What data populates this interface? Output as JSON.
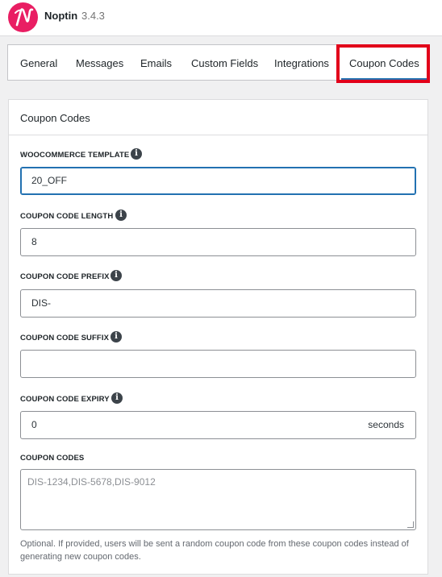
{
  "app": {
    "name": "Noptin",
    "version": "3.4.3"
  },
  "tabs": [
    {
      "label": "General",
      "active": false
    },
    {
      "label": "Messages",
      "active": false
    },
    {
      "label": "Emails",
      "active": false
    },
    {
      "label": "Custom Fields",
      "active": false
    },
    {
      "label": "Integrations",
      "active": false
    },
    {
      "label": "Coupon Codes",
      "active": true
    }
  ],
  "panel": {
    "title": "Coupon Codes",
    "fields": {
      "template": {
        "label": "WOOCOMMERCE TEMPLATE",
        "value": "20_OFF"
      },
      "length": {
        "label": "COUPON CODE LENGTH",
        "value": "8"
      },
      "prefix": {
        "label": "COUPON CODE PREFIX",
        "value": "DIS-"
      },
      "suffix": {
        "label": "COUPON CODE SUFFIX",
        "value": ""
      },
      "expiry": {
        "label": "COUPON CODE EXPIRY",
        "value": "0",
        "unit": "seconds"
      },
      "codes": {
        "label": "COUPON CODES",
        "placeholder": "DIS-1234,DIS-5678,DIS-9012",
        "help": "Optional. If provided, users will be sent a random coupon code from these coupon codes instead of generating new coupon codes."
      }
    }
  },
  "colors": {
    "brand": "#e91e63",
    "accent": "#2271b1",
    "highlight": "#e2001a"
  },
  "icons": {
    "info": "info-icon",
    "logo": "noptin-logo-icon"
  }
}
